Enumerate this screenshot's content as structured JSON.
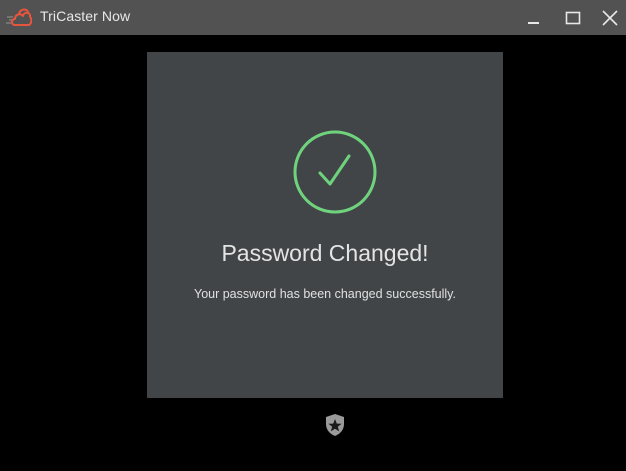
{
  "window": {
    "title": "TriCaster Now",
    "icons": {
      "app": "cloud-logo-icon",
      "minimize": "minimize-icon",
      "maximize": "maximize-icon",
      "close": "close-icon"
    }
  },
  "dialog": {
    "icon": "check-circle-icon",
    "title": "Password Changed!",
    "message": "Your password has been changed successfully."
  },
  "footer": {
    "icon": "shield-star-icon"
  },
  "colors": {
    "titlebar": "#525252",
    "background": "#000000",
    "card": "#424548",
    "accent_success": "#6fd37e",
    "logo": "#e8553d"
  }
}
